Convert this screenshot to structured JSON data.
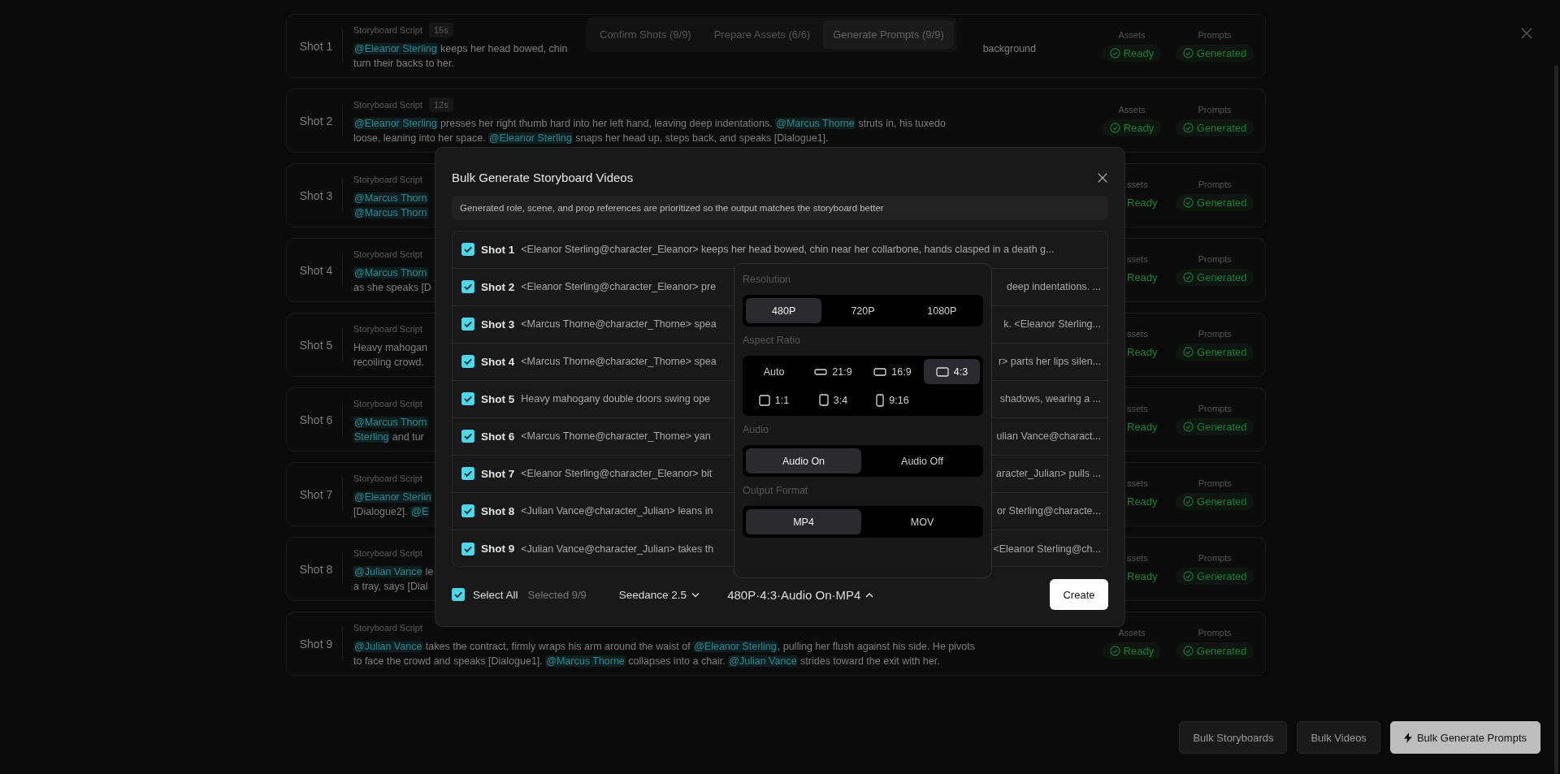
{
  "steps": [
    {
      "label": "Confirm Shots (9/9)",
      "selected": false
    },
    {
      "label": "Prepare Assets (6/6)",
      "selected": false
    },
    {
      "label": "Generate Prompts (9/9)",
      "selected": true
    }
  ],
  "shots": [
    {
      "label": "Shot 1",
      "script_label": "Storyboard Script",
      "duration": "15s",
      "lines": [
        {
          "parts": [
            [
              {
                "kind": "mention",
                "text": "@Eleanor Sterling"
              },
              {
                "kind": "text",
                "text": " keeps her head bowed, chin"
              }
            ],
            [
              {
                "kind": "text",
                "text": "background"
              }
            ]
          ]
        },
        {
          "parts": [
            [
              {
                "kind": "text",
                "text": "turn their backs to her."
              }
            ]
          ]
        }
      ],
      "statuses": [
        {
          "label": "Assets",
          "value": "Ready",
          "covered": false
        },
        {
          "label": "Prompts",
          "value": "Generated",
          "covered": false
        }
      ]
    },
    {
      "label": "Shot 2",
      "script_label": "Storyboard Script",
      "duration": "12s",
      "lines": [
        {
          "parts": [
            [
              {
                "kind": "mention",
                "text": "@Eleanor Sterling"
              },
              {
                "kind": "text",
                "text": " presses her right thumb hard into her left hand, leaving deep indentations. "
              },
              {
                "kind": "mention",
                "text": "@Marcus Thorne"
              },
              {
                "kind": "text",
                "text": " struts in, his tuxedo"
              }
            ]
          ]
        },
        {
          "parts": [
            [
              {
                "kind": "text",
                "text": "loose, leaning into her space. "
              },
              {
                "kind": "mention",
                "text": "@Eleanor Sterling"
              },
              {
                "kind": "text",
                "text": " snaps her head up, steps back, and speaks [Dialogue1]."
              }
            ]
          ]
        }
      ],
      "statuses": [
        {
          "label": "Assets",
          "value": "Ready",
          "covered": false
        },
        {
          "label": "Prompts",
          "value": "Generated",
          "covered": false
        }
      ]
    },
    {
      "label": "Shot 3",
      "script_label": "Storyboard Script",
      "lines": [
        {
          "parts": [
            [
              {
                "kind": "mention",
                "text": "@Marcus Thorn"
              }
            ]
          ]
        },
        {
          "parts": [
            [
              {
                "kind": "mention",
                "text": "@Marcus Thorn"
              }
            ]
          ]
        }
      ],
      "statuses": [
        {
          "label": "ssets",
          "value": "Ready",
          "covered": true
        },
        {
          "label": "Prompts",
          "value": "Generated",
          "covered": false
        }
      ]
    },
    {
      "label": "Shot 4",
      "script_label": "Storyboard Script",
      "lines": [
        {
          "parts": [
            [
              {
                "kind": "mention",
                "text": "@Marcus Thorn"
              }
            ]
          ]
        },
        {
          "parts": [
            [
              {
                "kind": "text",
                "text": "as she speaks [D"
              }
            ]
          ]
        }
      ],
      "statuses": [
        {
          "label": "ssets",
          "value": "Ready",
          "covered": true
        },
        {
          "label": "Prompts",
          "value": "Generated",
          "covered": false
        }
      ]
    },
    {
      "label": "Shot 5",
      "script_label": "Storyboard Script",
      "lines": [
        {
          "parts": [
            [
              {
                "kind": "text",
                "text": "Heavy mahogan"
              }
            ]
          ]
        },
        {
          "parts": [
            [
              {
                "kind": "text",
                "text": "recoiling crowd."
              }
            ]
          ]
        }
      ],
      "statuses": [
        {
          "label": "ssets",
          "value": "Ready",
          "covered": true
        },
        {
          "label": "Prompts",
          "value": "Generated",
          "covered": false
        }
      ]
    },
    {
      "label": "Shot 6",
      "script_label": "Storyboard Script",
      "lines": [
        {
          "parts": [
            [
              {
                "kind": "mention",
                "text": "@Marcus Thorn"
              }
            ]
          ]
        },
        {
          "parts": [
            [
              {
                "kind": "mention",
                "text": "Sterling"
              },
              {
                "kind": "text",
                "text": " and tur"
              }
            ]
          ]
        }
      ],
      "statuses": [
        {
          "label": "ssets",
          "value": "Ready",
          "covered": true
        },
        {
          "label": "Prompts",
          "value": "Generated",
          "covered": false
        }
      ]
    },
    {
      "label": "Shot 7",
      "script_label": "Storyboard Script",
      "lines": [
        {
          "parts": [
            [
              {
                "kind": "mention",
                "text": "@Eleanor Sterlin"
              }
            ]
          ]
        },
        {
          "parts": [
            [
              {
                "kind": "text",
                "text": "[Dialogue2]. "
              },
              {
                "kind": "mention",
                "text": "@E"
              }
            ]
          ]
        }
      ],
      "statuses": [
        {
          "label": "ssets",
          "value": "Ready",
          "covered": true
        },
        {
          "label": "Prompts",
          "value": "Generated",
          "covered": false
        }
      ]
    },
    {
      "label": "Shot 8",
      "script_label": "Storyboard Script",
      "lines": [
        {
          "parts": [
            [
              {
                "kind": "mention",
                "text": "@Julian Vance"
              },
              {
                "kind": "text",
                "text": " le"
              }
            ]
          ]
        },
        {
          "parts": [
            [
              {
                "kind": "text",
                "text": "a tray, says [Dial"
              }
            ]
          ]
        }
      ],
      "statuses": [
        {
          "label": "ssets",
          "value": "Ready",
          "covered": true
        },
        {
          "label": "Prompts",
          "value": "Generated",
          "covered": false
        }
      ]
    },
    {
      "label": "Shot 9",
      "script_label": "Storyboard Script",
      "lines": [
        {
          "parts": [
            [
              {
                "kind": "mention",
                "text": "@Julian Vance"
              },
              {
                "kind": "text",
                "text": " takes the contract, firmly wraps his arm around the waist of "
              },
              {
                "kind": "mention",
                "text": "@Eleanor Sterling"
              },
              {
                "kind": "text",
                "text": ", pulling her flush against his side. He pivots"
              }
            ]
          ]
        },
        {
          "parts": [
            [
              {
                "kind": "text",
                "text": "to face the crowd and speaks [Dialogue1]. "
              },
              {
                "kind": "mention",
                "text": "@Marcus Thorne"
              },
              {
                "kind": "text",
                "text": " collapses into a chair. "
              },
              {
                "kind": "mention",
                "text": "@Julian Vance"
              },
              {
                "kind": "text",
                "text": " strides toward the exit with her."
              }
            ]
          ]
        }
      ],
      "statuses": [
        {
          "label": "Assets",
          "value": "Ready",
          "covered": false
        },
        {
          "label": "Prompts",
          "value": "Generated",
          "covered": false
        }
      ]
    }
  ],
  "modal": {
    "title": "Bulk Generate Storyboard Videos",
    "notice": "Generated role, scene, and prop references are prioritized so the output matches the storyboard better",
    "shots": [
      {
        "label": "Shot 1",
        "checked": true,
        "parts": [
          "<Eleanor Sterling@character_Eleanor> keeps her head bowed, chin near her collarbone, hands clasped in a death g..."
        ]
      },
      {
        "label": "Shot 2",
        "checked": true,
        "parts": [
          "<Eleanor Sterling@character_Eleanor> pre",
          "deep indentations. ..."
        ]
      },
      {
        "label": "Shot 3",
        "checked": true,
        "parts": [
          "<Marcus Thorne@character_Thorne> spea",
          "k. <Eleanor Sterling..."
        ]
      },
      {
        "label": "Shot 4",
        "checked": true,
        "parts": [
          "<Marcus Thorne@character_Thorne> spea",
          "r> parts her lips silen..."
        ]
      },
      {
        "label": "Shot 5",
        "checked": true,
        "parts": [
          "Heavy mahogany double doors swing ope",
          "shadows, wearing a ..."
        ]
      },
      {
        "label": "Shot 6",
        "checked": true,
        "parts": [
          "<Marcus Thorne@character_Thorne> yan",
          "ulian Vance@charact..."
        ]
      },
      {
        "label": "Shot 7",
        "checked": true,
        "parts": [
          "<Eleanor Sterling@character_Eleanor> bit",
          "aracter_Julian> pulls ..."
        ]
      },
      {
        "label": "Shot 8",
        "checked": true,
        "parts": [
          "<Julian Vance@character_Julian> leans in",
          "or Sterling@characte..."
        ]
      },
      {
        "label": "Shot 9",
        "checked": true,
        "parts": [
          "<Julian Vance@character_Julian> takes th",
          "<Eleanor Sterling@ch..."
        ]
      }
    ],
    "select_all": {
      "label": "Select All",
      "checked": true
    },
    "selected_count": "Selected 9/9",
    "model": "Seedance 2.5",
    "settings": {
      "summary": "480P·4:3·Audio On·MP4",
      "expanded": true
    },
    "create": "Create"
  },
  "popover": {
    "sections": [
      {
        "title": "Resolution",
        "kind": "resolution",
        "options": [
          {
            "label": "480P",
            "kind": "plain",
            "selected": true
          },
          {
            "label": "720P",
            "kind": "plain",
            "selected": false
          },
          {
            "label": "1080P",
            "kind": "plain",
            "selected": false
          }
        ]
      },
      {
        "title": "Aspect Ratio",
        "kind": "aspect",
        "options": [
          {
            "label": "Auto",
            "kind": "auto",
            "selected": false
          },
          {
            "label": "21:9",
            "kind": "ratio",
            "selected": false
          },
          {
            "label": "16:9",
            "kind": "ratio",
            "selected": false
          },
          {
            "label": "4:3",
            "kind": "ratio",
            "selected": true
          },
          {
            "label": "1:1",
            "kind": "ratio",
            "selected": false
          },
          {
            "label": "3:4",
            "kind": "ratio",
            "selected": false
          },
          {
            "label": "9:16",
            "kind": "ratio",
            "selected": false
          }
        ]
      },
      {
        "title": "Audio",
        "kind": "audio",
        "options": [
          {
            "label": "Audio On",
            "kind": "plain",
            "selected": true
          },
          {
            "label": "Audio Off",
            "kind": "plain",
            "selected": false
          }
        ]
      },
      {
        "title": "Output Format",
        "kind": "format",
        "options": [
          {
            "label": "MP4",
            "kind": "plain",
            "selected": true
          },
          {
            "label": "MOV",
            "kind": "plain",
            "selected": false
          }
        ]
      }
    ]
  },
  "actions": [
    {
      "label": "Bulk Storyboards",
      "kind": "secondary"
    },
    {
      "label": "Bulk Videos",
      "kind": "secondary"
    },
    {
      "label": "Bulk Generate Prompts",
      "kind": "primary"
    }
  ]
}
